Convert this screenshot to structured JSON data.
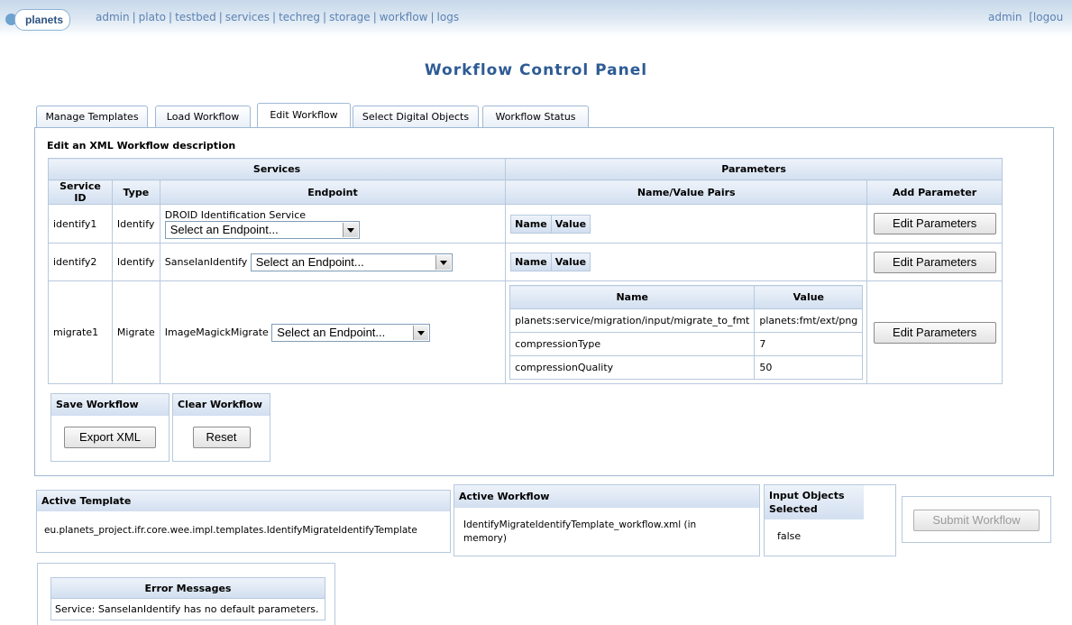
{
  "logo": {
    "text": "planets"
  },
  "nav": {
    "items": [
      "admin",
      "plato",
      "testbed",
      "services",
      "techreg",
      "storage",
      "workflow",
      "logs"
    ]
  },
  "user": {
    "name": "admin",
    "logout": "[logou"
  },
  "page_title": "Workflow Control Panel",
  "tabs": [
    {
      "label": "Manage Templates"
    },
    {
      "label": "Load Workflow"
    },
    {
      "label": "Edit Workflow"
    },
    {
      "label": "Select Digital Objects"
    },
    {
      "label": "Workflow Status"
    }
  ],
  "edit": {
    "caption": "Edit an XML Workflow description",
    "headers": {
      "services": "Services",
      "parameters": "Parameters",
      "service_id": "Service ID",
      "type": "Type",
      "endpoint": "Endpoint",
      "nvp": "Name/Value Pairs",
      "add_param": "Add Parameter"
    },
    "nvp_name": "Name",
    "nvp_value": "Value",
    "edit_params_label": "Edit Parameters",
    "select_placeholder": "Select an Endpoint...",
    "rows": [
      {
        "id": "identify1",
        "type": "Identify",
        "service": "DROID Identification Service"
      },
      {
        "id": "identify2",
        "type": "Identify",
        "service": "SanselanIdentify"
      },
      {
        "id": "migrate1",
        "type": "Migrate",
        "service": "ImageMagickMigrate"
      }
    ],
    "migrate_params": [
      {
        "name": "planets:service/migration/input/migrate_to_fmt",
        "value": "planets:fmt/ext/png"
      },
      {
        "name": "compressionType",
        "value": "7"
      },
      {
        "name": "compressionQuality",
        "value": "50"
      }
    ],
    "save": {
      "title": "Save Workflow",
      "button": "Export XML"
    },
    "clear": {
      "title": "Clear Workflow",
      "button": "Reset"
    }
  },
  "active_template": {
    "title": "Active Template",
    "value": "eu.planets_project.ifr.core.wee.impl.templates.IdentifyMigrateIdentifyTemplate"
  },
  "active_workflow": {
    "title": "Active Workflow",
    "value": "IdentifyMigrateIdentifyTemplate_workflow.xml (in memory)"
  },
  "input_objects": {
    "title": "Input Objects Selected",
    "value": "false"
  },
  "submit": {
    "label": "Submit Workflow"
  },
  "errors": {
    "title": "Error Messages",
    "message": "Service: SanselanIdentify has no default parameters."
  }
}
